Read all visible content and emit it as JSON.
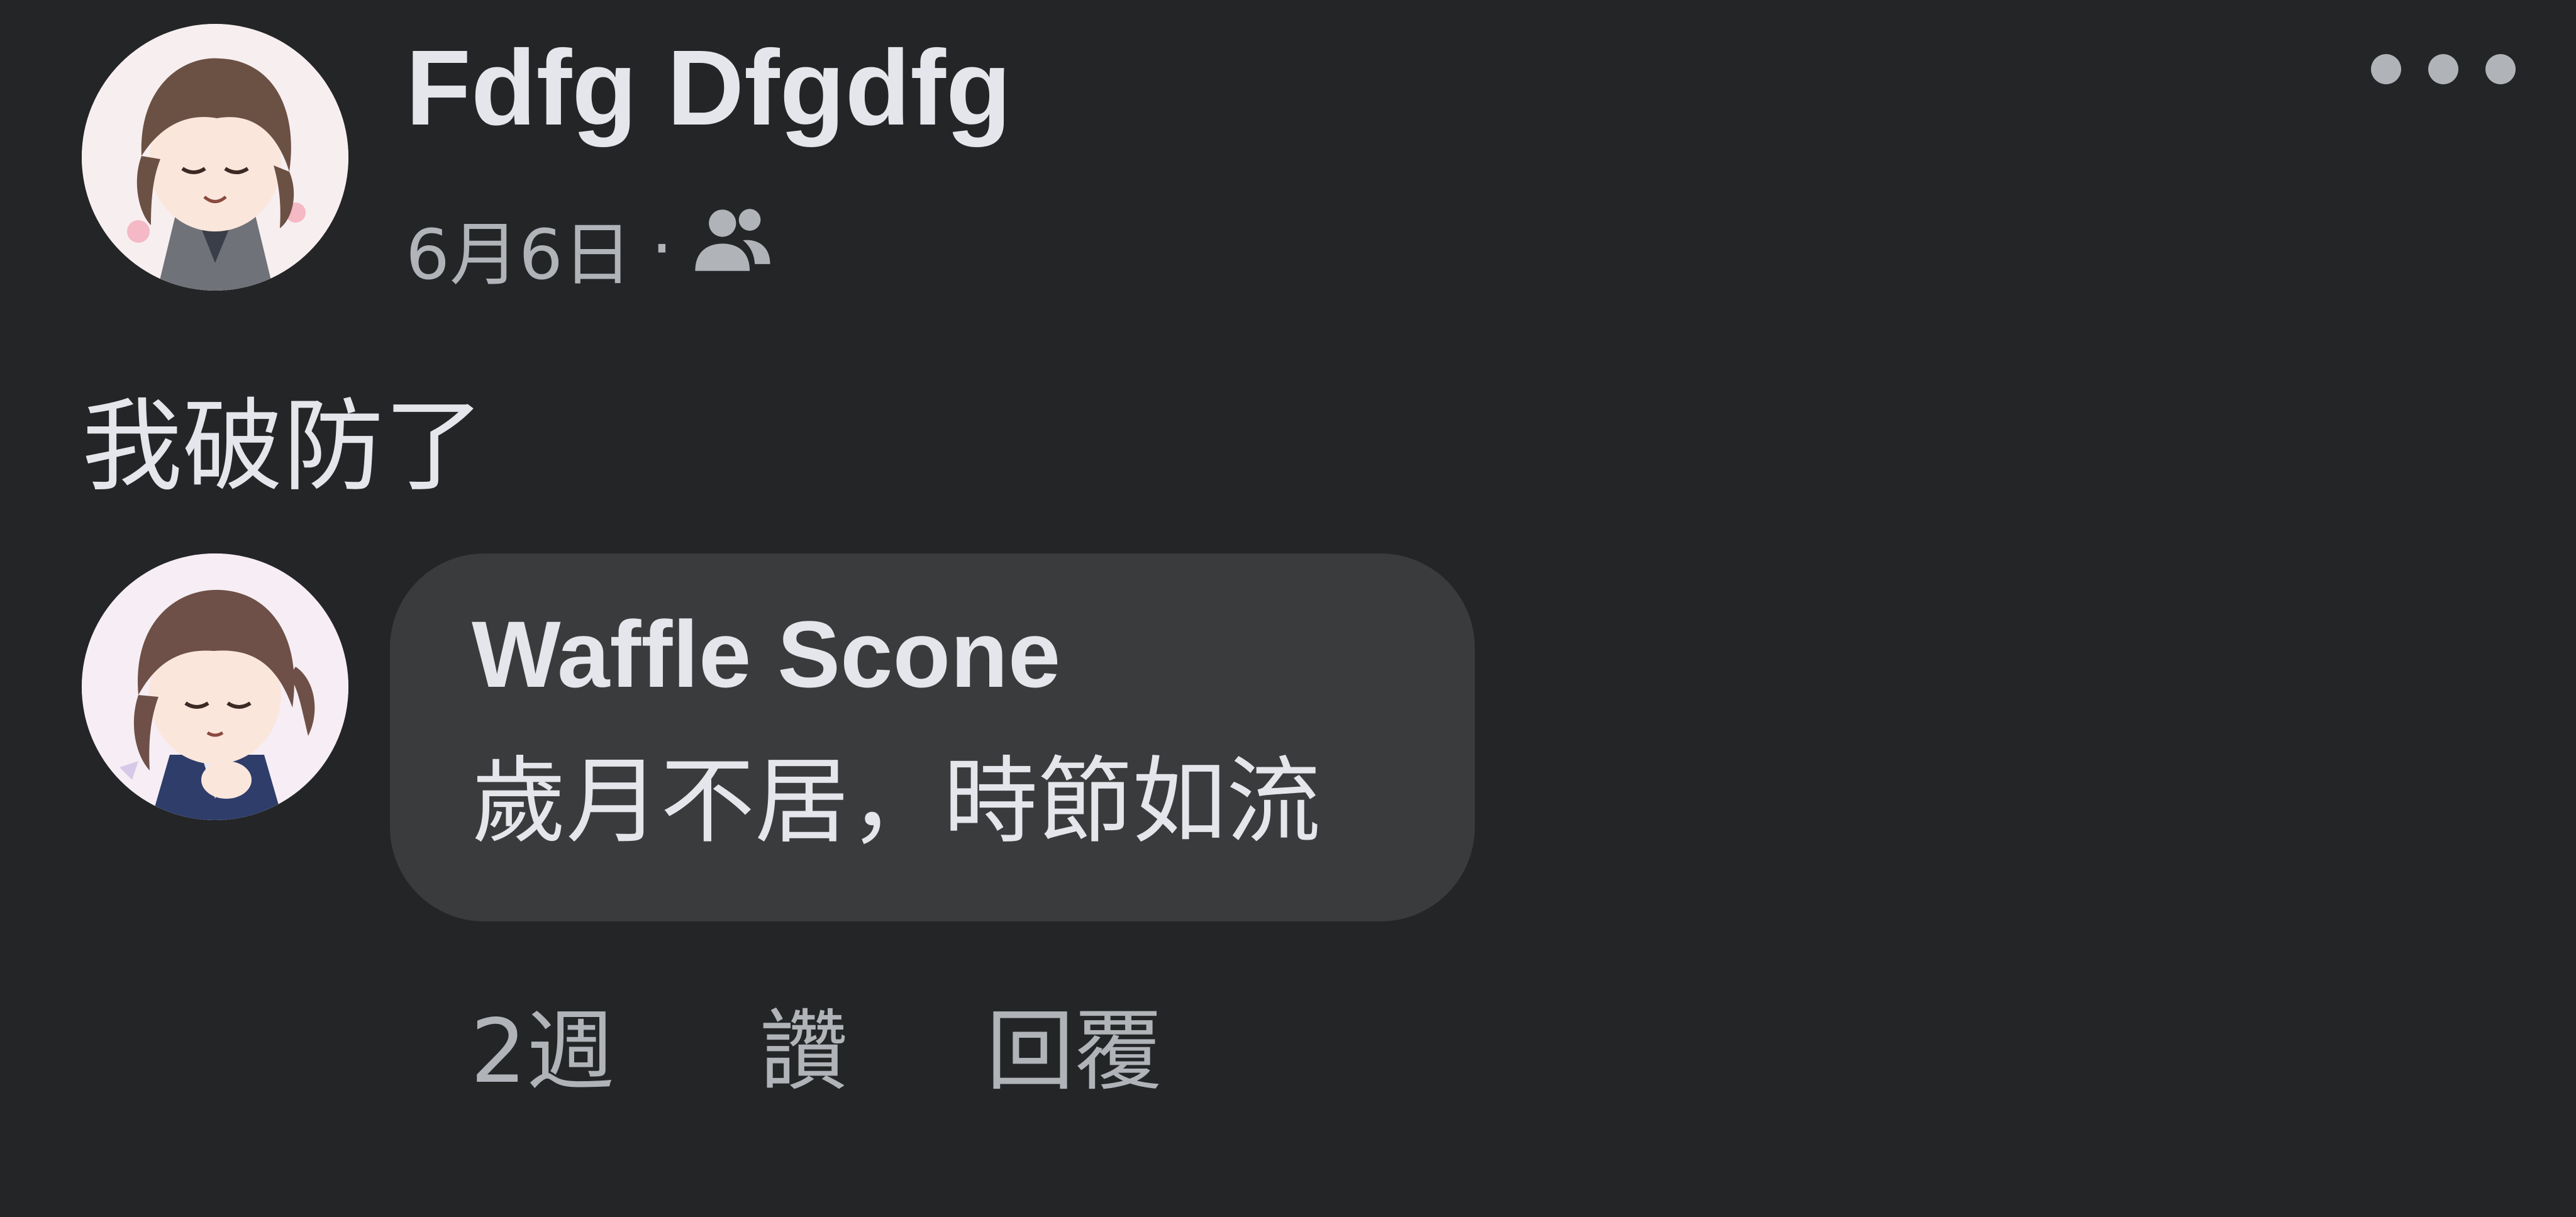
{
  "post": {
    "author": "Fdfg Dfgdfg",
    "date": "6月6日",
    "separator": "·",
    "audience_icon": "friends-icon",
    "text": "我破防了",
    "more_icon": "more-horizontal-icon"
  },
  "comment": {
    "author": "Waffle Scone",
    "text": "歲月不居，時節如流",
    "time": "2週",
    "like_label": "讚",
    "reply_label": "回覆"
  },
  "colors": {
    "background": "#242527",
    "bubble": "#3a3b3c",
    "primary_text": "#e4e6eb",
    "secondary_text": "#b0b3b8"
  }
}
